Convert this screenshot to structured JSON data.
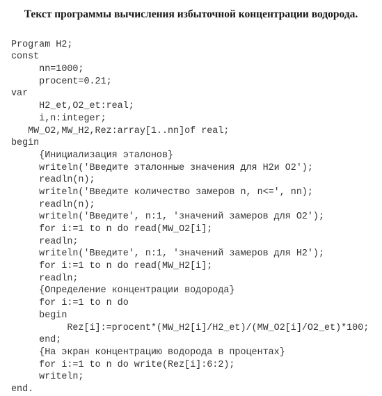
{
  "title": "Текст программы вычисления избыточной концентрации водорода.",
  "code": {
    "l1": "Program H2;",
    "l2": "const",
    "l3": "     nn=1000;",
    "l4": "     procent=0.21;",
    "l5": "var",
    "l6": "     H2_et,O2_et:real;",
    "l7": "     i,n:integer;",
    "l8": "   MW_O2,MW_H2,Rez:array[1..nn]of real;",
    "l9": "begin",
    "l10": "     {Инициализация эталонов}",
    "l11": "     writeln('Введите эталонные значения для Н2и О2');",
    "l12": "     readln(n);",
    "l13": "     writeln('Введите количество замеров n, n<=', nn);",
    "l14": "     readln(n);",
    "l15": "     writeln('Введите', n:1, 'значений замеров для О2');",
    "l16": "     for i:=1 to n do read(MW_O2[i];",
    "l17": "     readln;",
    "l18": "     writeln('Введите', n:1, 'значений замеров для Н2');",
    "l19": "     for i:=1 to n do read(MW_H2[i];",
    "l20": "     readln;",
    "l21": "     {Определение концентрации водорода}",
    "l22": "     for i:=1 to n do",
    "l23": "     begin",
    "l24": "          Rez[i]:=procent*(MW_H2[i]/H2_et)/(MW_O2[i]/O2_et)*100;",
    "l25": "     end;",
    "l26": "     {На экран концентрацию водорода в процентах}",
    "l27": "     for i:=1 to n do write(Rez[i]:6:2);",
    "l28": "     writeln;",
    "l29": "end."
  }
}
